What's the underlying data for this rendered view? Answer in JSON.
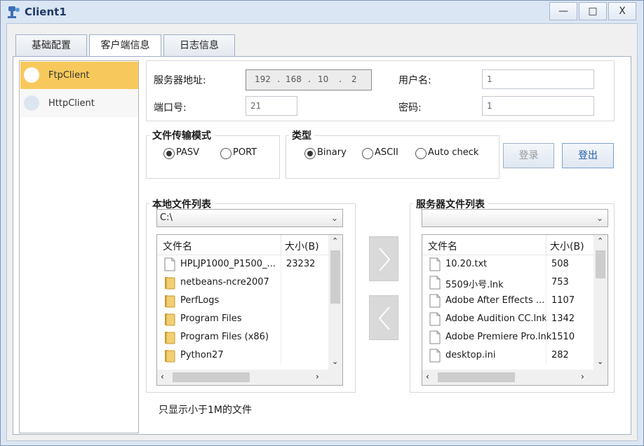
{
  "window": {
    "title": "Client1",
    "minimize_label": "—",
    "maximize_label": "□",
    "close_label": "X"
  },
  "tabs": [
    {
      "label": "基础配置"
    },
    {
      "label": "客户端信息"
    },
    {
      "label": "日志信息"
    }
  ],
  "sidebar": {
    "items": [
      {
        "label": "FtpClient",
        "selected": true
      },
      {
        "label": "HttpClient",
        "selected": false
      }
    ]
  },
  "server": {
    "address_label": "服务器地址:",
    "ip": [
      "192",
      "168",
      "10",
      "2"
    ],
    "port_label": "端口号:",
    "port_value": "21",
    "username_label": "用户名:",
    "username_value": "1",
    "password_label": "密码:",
    "password_value": "1"
  },
  "transfer_mode": {
    "title": "文件传输模式",
    "options": [
      {
        "label": "PASV",
        "checked": true
      },
      {
        "label": "PORT",
        "checked": false
      }
    ]
  },
  "type": {
    "title": "类型",
    "options": [
      {
        "label": "Binary",
        "checked": true
      },
      {
        "label": "ASCII",
        "checked": false
      },
      {
        "label": "Auto check",
        "checked": false
      }
    ]
  },
  "buttons": {
    "login": "登录",
    "logout": "登出"
  },
  "local": {
    "title": "本地文件列表",
    "path": "C:\\",
    "columns": {
      "name": "文件名",
      "size": "大小(B)"
    },
    "files": [
      {
        "name": "HPLJP1000_P1500_...",
        "size": "23232",
        "icon": "file-icon"
      },
      {
        "name": "netbeans-ncre2007",
        "size": "",
        "icon": "folder-icon"
      },
      {
        "name": "PerfLogs",
        "size": "",
        "icon": "folder-icon"
      },
      {
        "name": "Program Files",
        "size": "",
        "icon": "folder-icon"
      },
      {
        "name": "Program Files (x86)",
        "size": "",
        "icon": "folder-icon"
      },
      {
        "name": "Python27",
        "size": "",
        "icon": "folder-icon"
      }
    ]
  },
  "remote": {
    "title": "服务器文件列表",
    "path": "",
    "columns": {
      "name": "文件名",
      "size": "大小(B)"
    },
    "files": [
      {
        "name": "10.20.txt",
        "size": "508",
        "icon": "file-icon"
      },
      {
        "name": "5509小号.lnk",
        "size": "753",
        "icon": "file-icon"
      },
      {
        "name": "Adobe After Effects ...",
        "size": "1107",
        "icon": "file-icon"
      },
      {
        "name": "Adobe Audition CC.lnk",
        "size": "1342",
        "icon": "file-icon"
      },
      {
        "name": "Adobe Premiere Pro.lnk",
        "size": "1510",
        "icon": "file-icon"
      },
      {
        "name": "desktop.ini",
        "size": "282",
        "icon": "file-icon"
      }
    ]
  },
  "footer_note": "只显示小于1M的文件",
  "colors": {
    "selected_item": "#f7c95c",
    "title_text": "#1f3a66",
    "logout_accent": "#1f5aa6"
  }
}
